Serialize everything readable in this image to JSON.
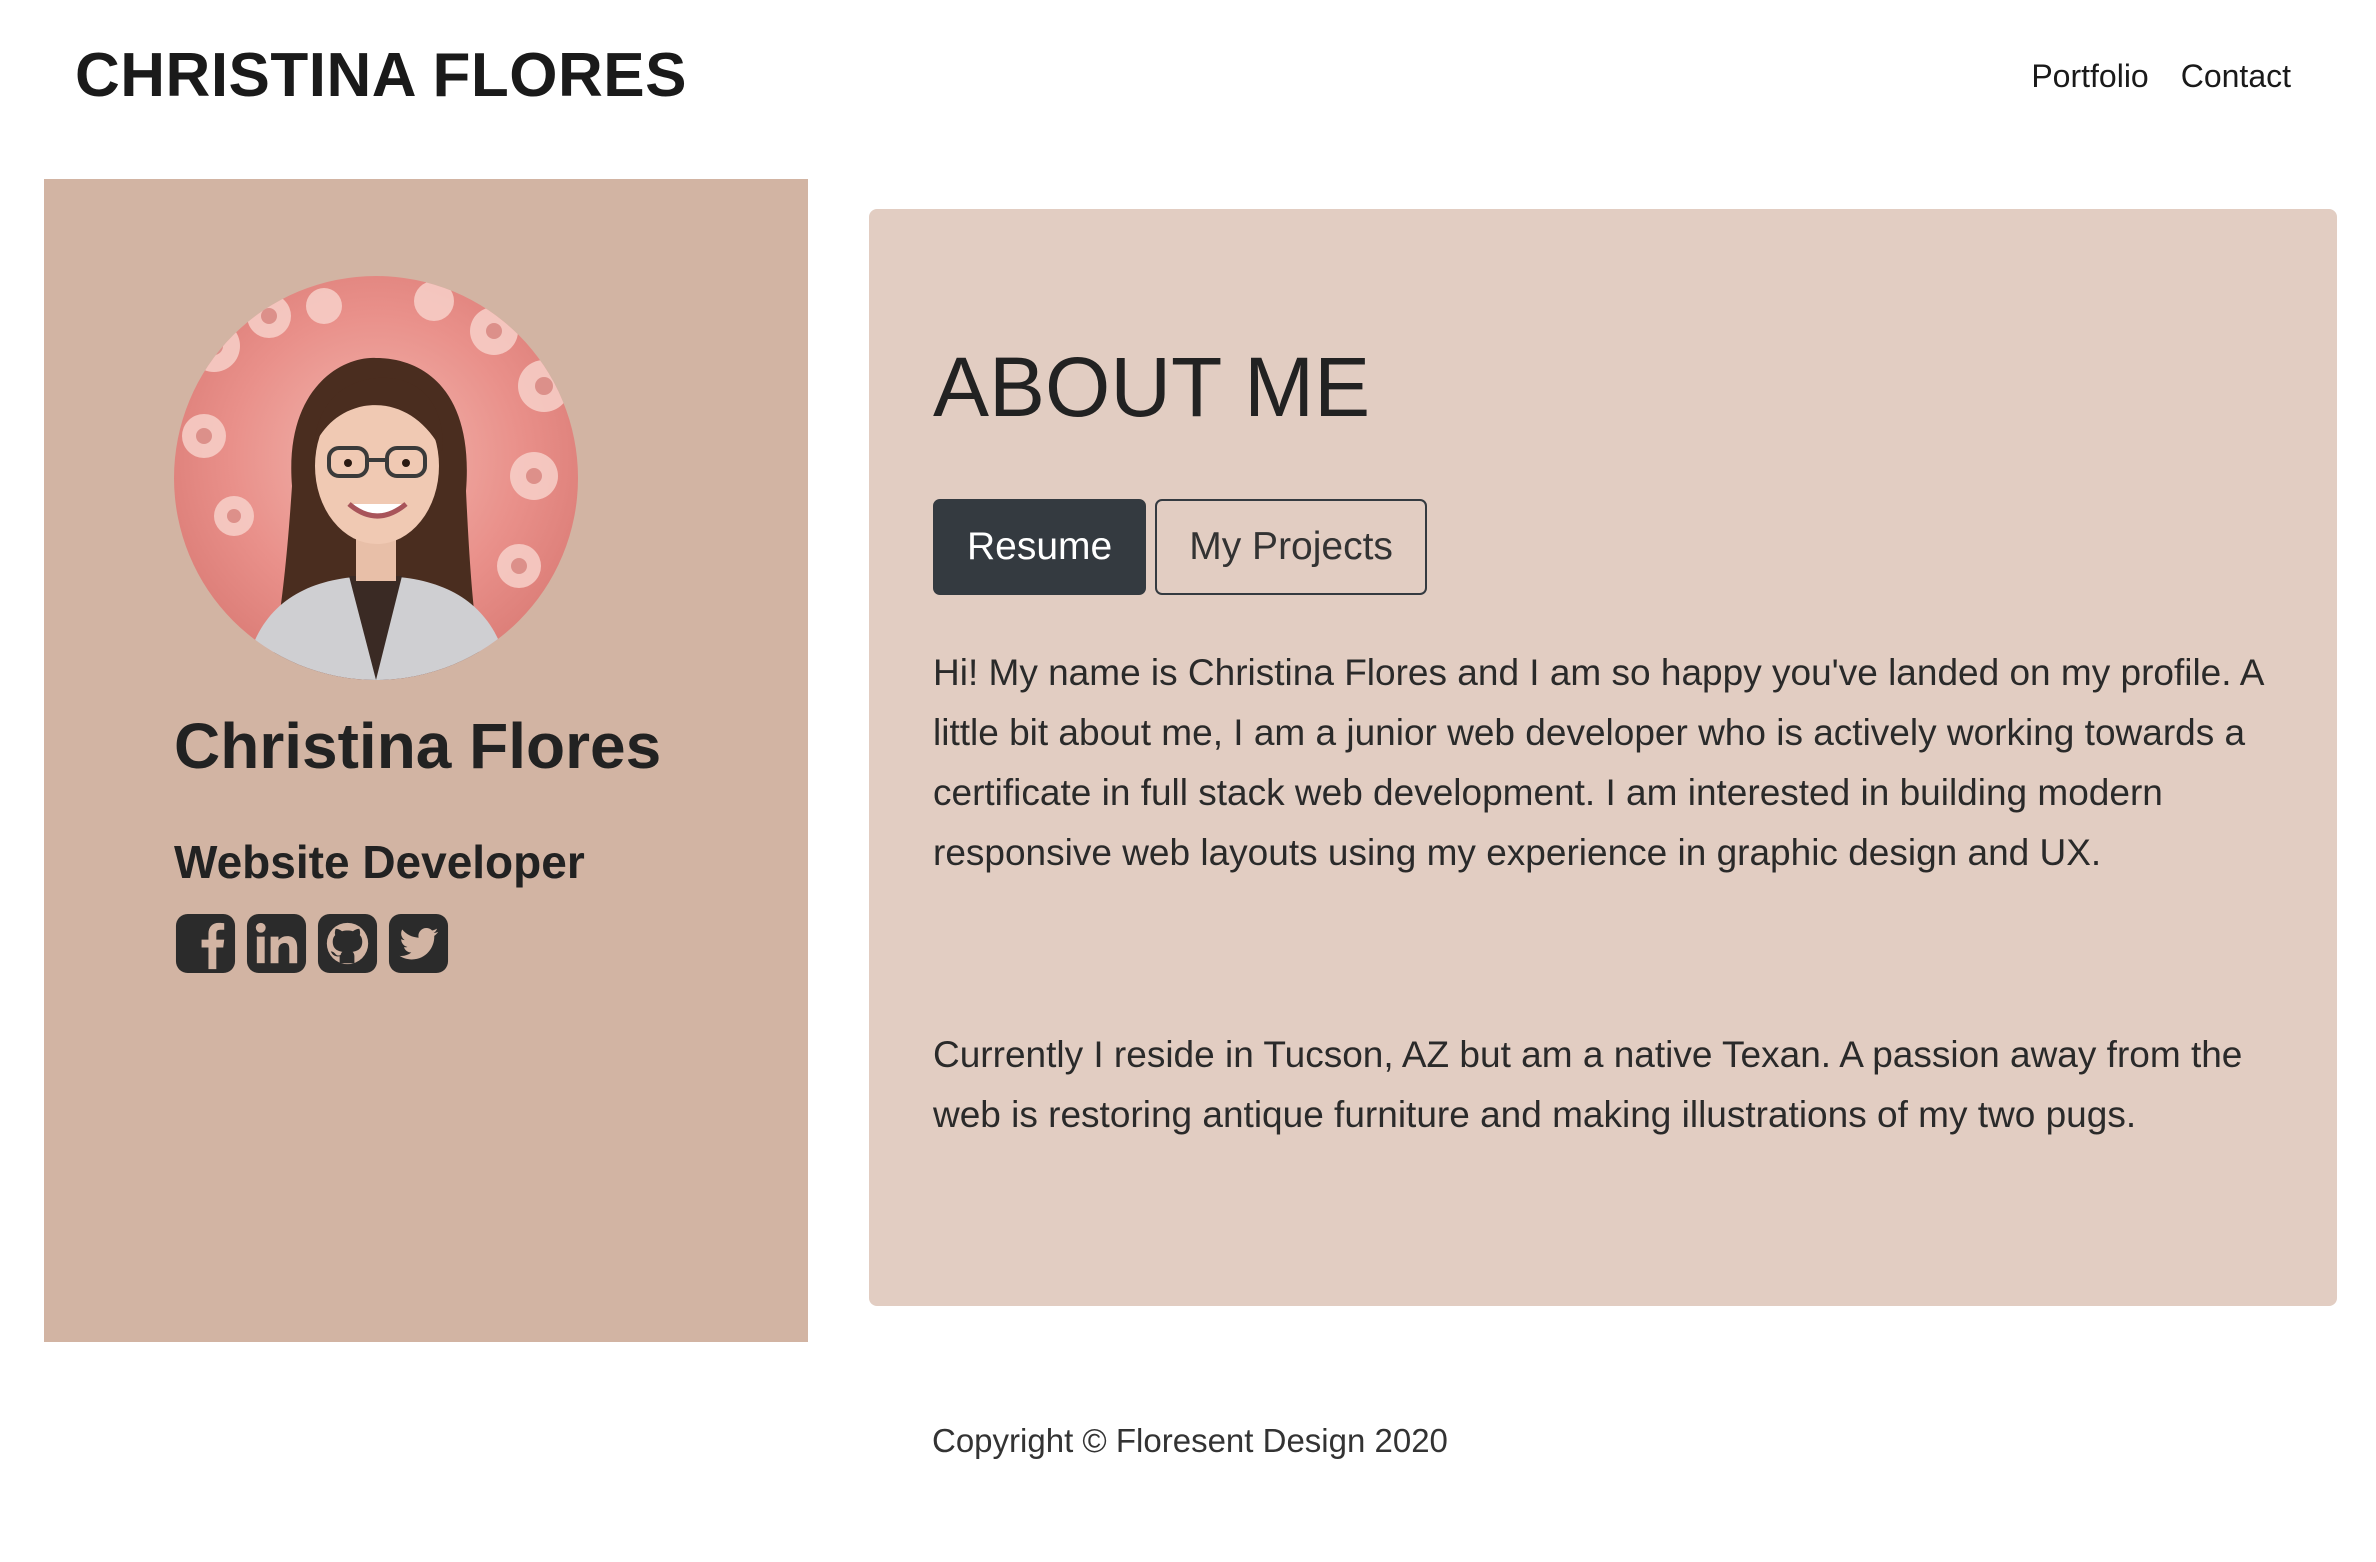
{
  "header": {
    "brand": "CHRISTINA FLORES",
    "nav": [
      {
        "label": "Portfolio"
      },
      {
        "label": "Contact"
      }
    ]
  },
  "sidebar": {
    "name": "Christina Flores",
    "title": "Website Developer",
    "socials": [
      "facebook-icon",
      "linkedin-icon",
      "github-icon",
      "twitter-icon"
    ]
  },
  "about": {
    "heading": "ABOUT ME",
    "tabs": [
      {
        "label": "Resume",
        "active": true
      },
      {
        "label": "My Projects",
        "active": false
      }
    ],
    "paragraphs": [
      "Hi! My name is Christina Flores and I am so happy you've landed on my profile. A little bit about me, I am a junior web developer who is actively working towards a certificate in full stack web development. I am interested in building modern responsive web layouts using my experience in graphic design and UX.",
      "Currently I reside in Tucson, AZ but am a native Texan. A passion away from the web is restoring antique furniture and making illustrations of my two pugs."
    ]
  },
  "footer": {
    "copyright": "Copyright © Floresent Design 2020"
  },
  "colors": {
    "sidebar_bg": "#d2b4a3",
    "card_bg": "#e2cdc2",
    "dark_button": "#343a40",
    "text": "#212529"
  }
}
